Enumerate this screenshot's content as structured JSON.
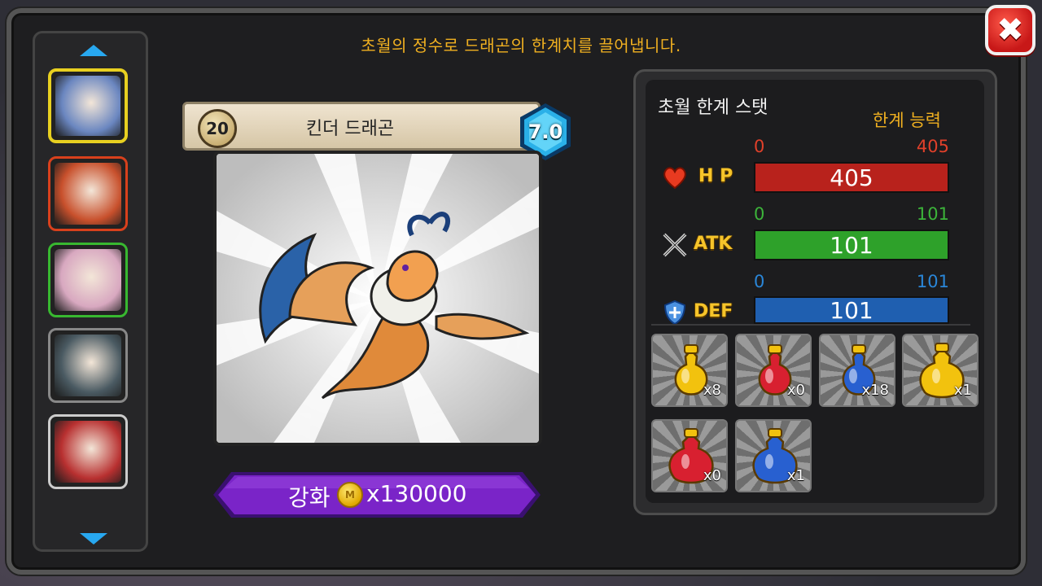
{
  "header": {
    "description": "초월의 정수로 드래곤의 한계치를 끌어냅니다."
  },
  "close_button": {
    "label": "✖"
  },
  "dragon_list": {
    "items": [
      {
        "name": "kinder-dragon",
        "selected": true,
        "border": "#e8d020",
        "bg": "#6a86c0"
      },
      {
        "name": "fire-dragon",
        "selected": false,
        "border": "#d8401c",
        "bg": "#c8502c"
      },
      {
        "name": "fairy-dragon",
        "selected": false,
        "border": "#38b830",
        "bg": "#d8a8c0"
      },
      {
        "name": "stone-dragon",
        "selected": false,
        "border": "#888888",
        "bg": "#4a5a62"
      },
      {
        "name": "blade-dragon",
        "selected": false,
        "border": "#cccccc",
        "bg": "#b83030"
      }
    ]
  },
  "card": {
    "level": "20",
    "name": "킨더 드래곤",
    "grade": "7.0"
  },
  "enhance": {
    "label": "강화",
    "coin_symbol": "M",
    "cost": "x130000"
  },
  "stats": {
    "title": "초월 한계 스탯",
    "limit_label": "한계 능력",
    "rows": [
      {
        "key": "hp",
        "label": "H P",
        "min": "0",
        "max": "405",
        "value": "405",
        "fill": 1.0,
        "color": "#b8221c",
        "range_color": "#e0402a"
      },
      {
        "key": "atk",
        "label": "ATK",
        "min": "0",
        "max": "101",
        "value": "101",
        "fill": 1.0,
        "color": "#2ea12a",
        "range_color": "#3cb43a"
      },
      {
        "key": "def",
        "label": "DEF",
        "min": "0",
        "max": "101",
        "value": "101",
        "fill": 1.0,
        "color": "#1f5fb0",
        "range_color": "#2a86d8"
      }
    ]
  },
  "potions": [
    {
      "name": "gold-small-potion",
      "qty": "x8",
      "color": "#f2c20e"
    },
    {
      "name": "red-small-potion",
      "qty": "x0",
      "color": "#d82030"
    },
    {
      "name": "blue-small-potion",
      "qty": "x18",
      "color": "#2860d0"
    },
    {
      "name": "gold-large-potion",
      "qty": "x1",
      "color": "#f2c20e"
    },
    {
      "name": "red-large-potion",
      "qty": "x0",
      "color": "#d82030"
    },
    {
      "name": "blue-large-potion",
      "qty": "x1",
      "color": "#2860d0"
    }
  ]
}
